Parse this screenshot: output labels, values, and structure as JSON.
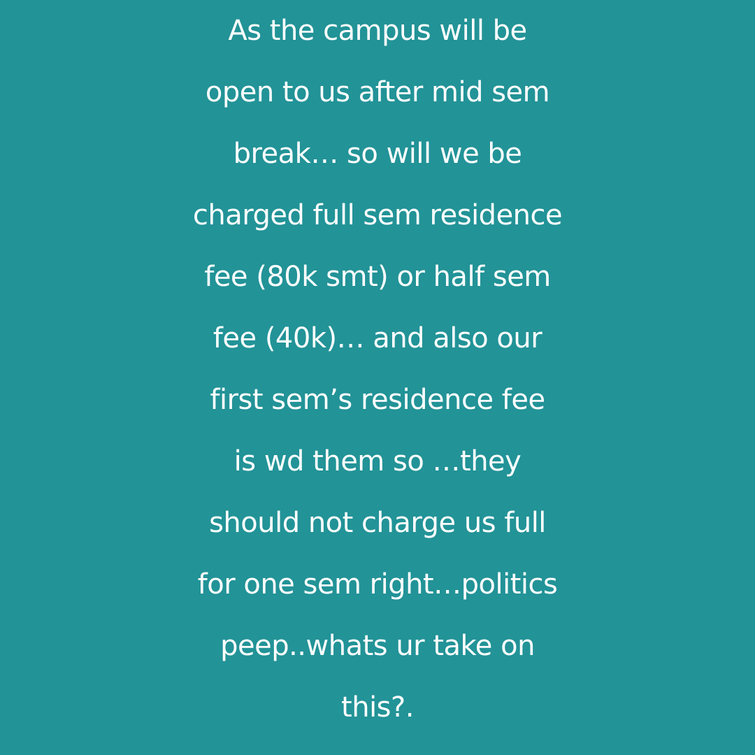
{
  "post": {
    "background_color": "#229397",
    "text_color": "#ffffff",
    "lines": [
      "As the campus will be",
      "open to us after mid sem",
      "break… so will we be",
      "charged full sem residence",
      "fee (80k smt) or half sem",
      "fee (40k)… and also our",
      "first sem’s residence fee",
      "is wd them so …they",
      "should not charge us full",
      "for one sem right…politics",
      "peep..whats ur take on",
      "this?."
    ]
  }
}
